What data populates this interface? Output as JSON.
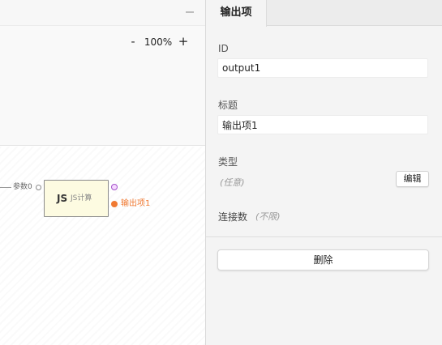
{
  "canvas": {
    "zoom": {
      "out_label": "-",
      "level": "100%",
      "in_label": "+"
    },
    "node": {
      "input_label": "参数0",
      "badge": "JS",
      "title": "JS计算",
      "output_label": "输出项1",
      "output_color": "#f07a33",
      "selected_port_color": "#a352c9",
      "fill_color": "#fdfbe1"
    }
  },
  "panel": {
    "tab_label": "输出项",
    "id_label": "ID",
    "id_value": "output1",
    "title_label": "标题",
    "title_value": "输出项1",
    "type_label": "类型",
    "type_value": "(任意)",
    "edit_label": "编辑",
    "connections_label": "连接数",
    "connections_value": "(不限)",
    "delete_label": "删除"
  }
}
